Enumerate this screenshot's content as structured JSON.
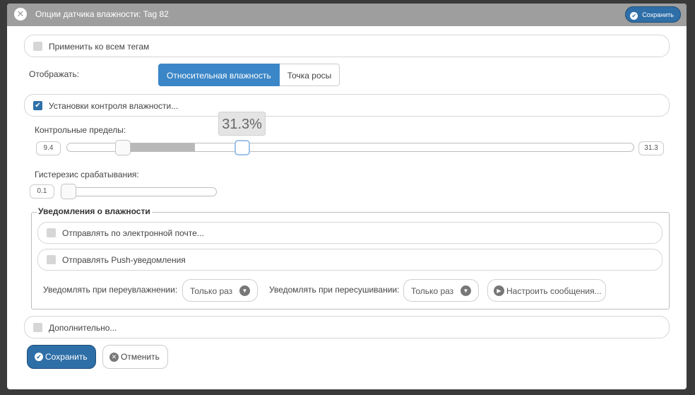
{
  "titlebar": {
    "title": "Опции датчика влажности: Tag 82",
    "save_label": "Сохранить"
  },
  "apply_all": {
    "label": "Применить ко всем тегам",
    "checked": false
  },
  "display": {
    "label": "Отображать:",
    "options": [
      "Относительная влажность",
      "Точка росы"
    ],
    "selected": "Относительная влажность"
  },
  "monitor": {
    "label": "Установки контроля влажности...",
    "checked": true
  },
  "limits": {
    "label": "Контрольные пределы:",
    "min_value": "9.4",
    "max_value": "31.3",
    "tooltip": "31.3%",
    "low_fraction": 0.1,
    "fill_end_fraction": 0.225,
    "high_fraction": 0.31
  },
  "hysteresis": {
    "label": "Гистерезис срабатывания:",
    "value": "0.1",
    "fraction": 0.0
  },
  "notifications": {
    "legend": "Уведомления о влажности",
    "email": {
      "label": "Отправлять по электронной почте...",
      "checked": false
    },
    "push": {
      "label": "Отправлять Push-уведомления",
      "checked": false
    },
    "too_wet_label": "Уведомлять при переувлажнении:",
    "too_wet_value": "Только раз",
    "too_dry_label": "Уведомлять при пересушивании:",
    "too_dry_value": "Только раз",
    "customize_label": "Настроить сообщения..."
  },
  "advanced": {
    "label": "Дополнительно...",
    "checked": false
  },
  "footer": {
    "save_label": "Сохранить",
    "cancel_label": "Отменить"
  },
  "colors": {
    "accent": "#3b86c7",
    "primary_button": "#2f6fa8",
    "titlebar": "#9e9e9e"
  }
}
